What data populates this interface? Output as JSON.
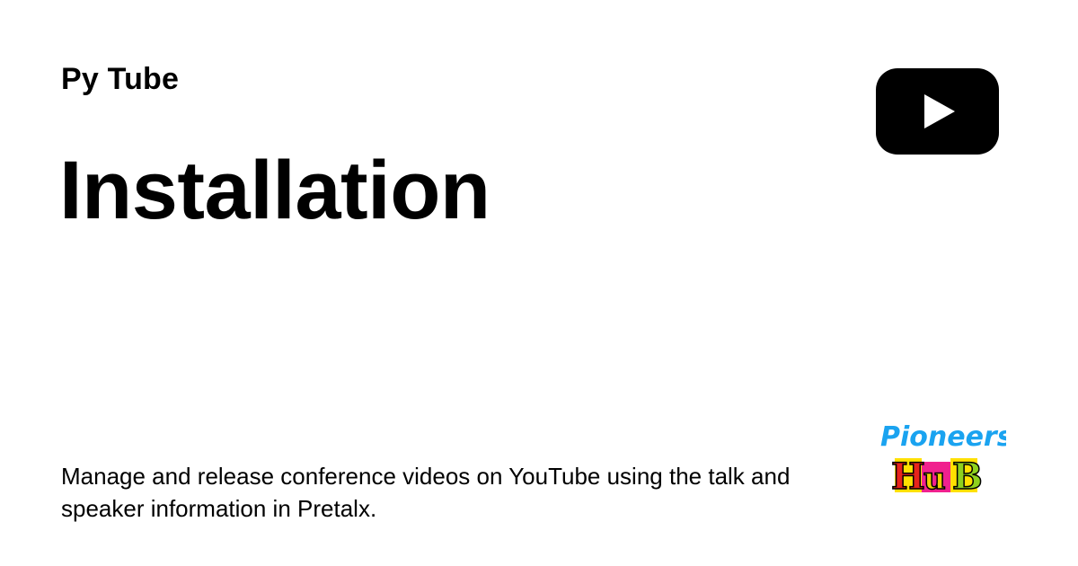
{
  "header": {
    "site_name": "Py Tube"
  },
  "page": {
    "title": "Installation",
    "description": "Manage and release conference videos on YouTube using the talk and speaker information in Pretalx."
  },
  "logos": {
    "youtube": {
      "icon": "youtube-play-icon",
      "color": "#000000",
      "play_color": "#ffffff"
    },
    "brand": {
      "word_top": "Pioneers",
      "letters_bottom": [
        "H",
        "u",
        "B"
      ],
      "color_top": "#1aa3f0",
      "letter_colors": [
        "#e8231b",
        "#f0d000",
        "#8ed11e"
      ],
      "block_colors": [
        "#ffe000",
        "#f0218e",
        "#ffe000"
      ]
    }
  }
}
